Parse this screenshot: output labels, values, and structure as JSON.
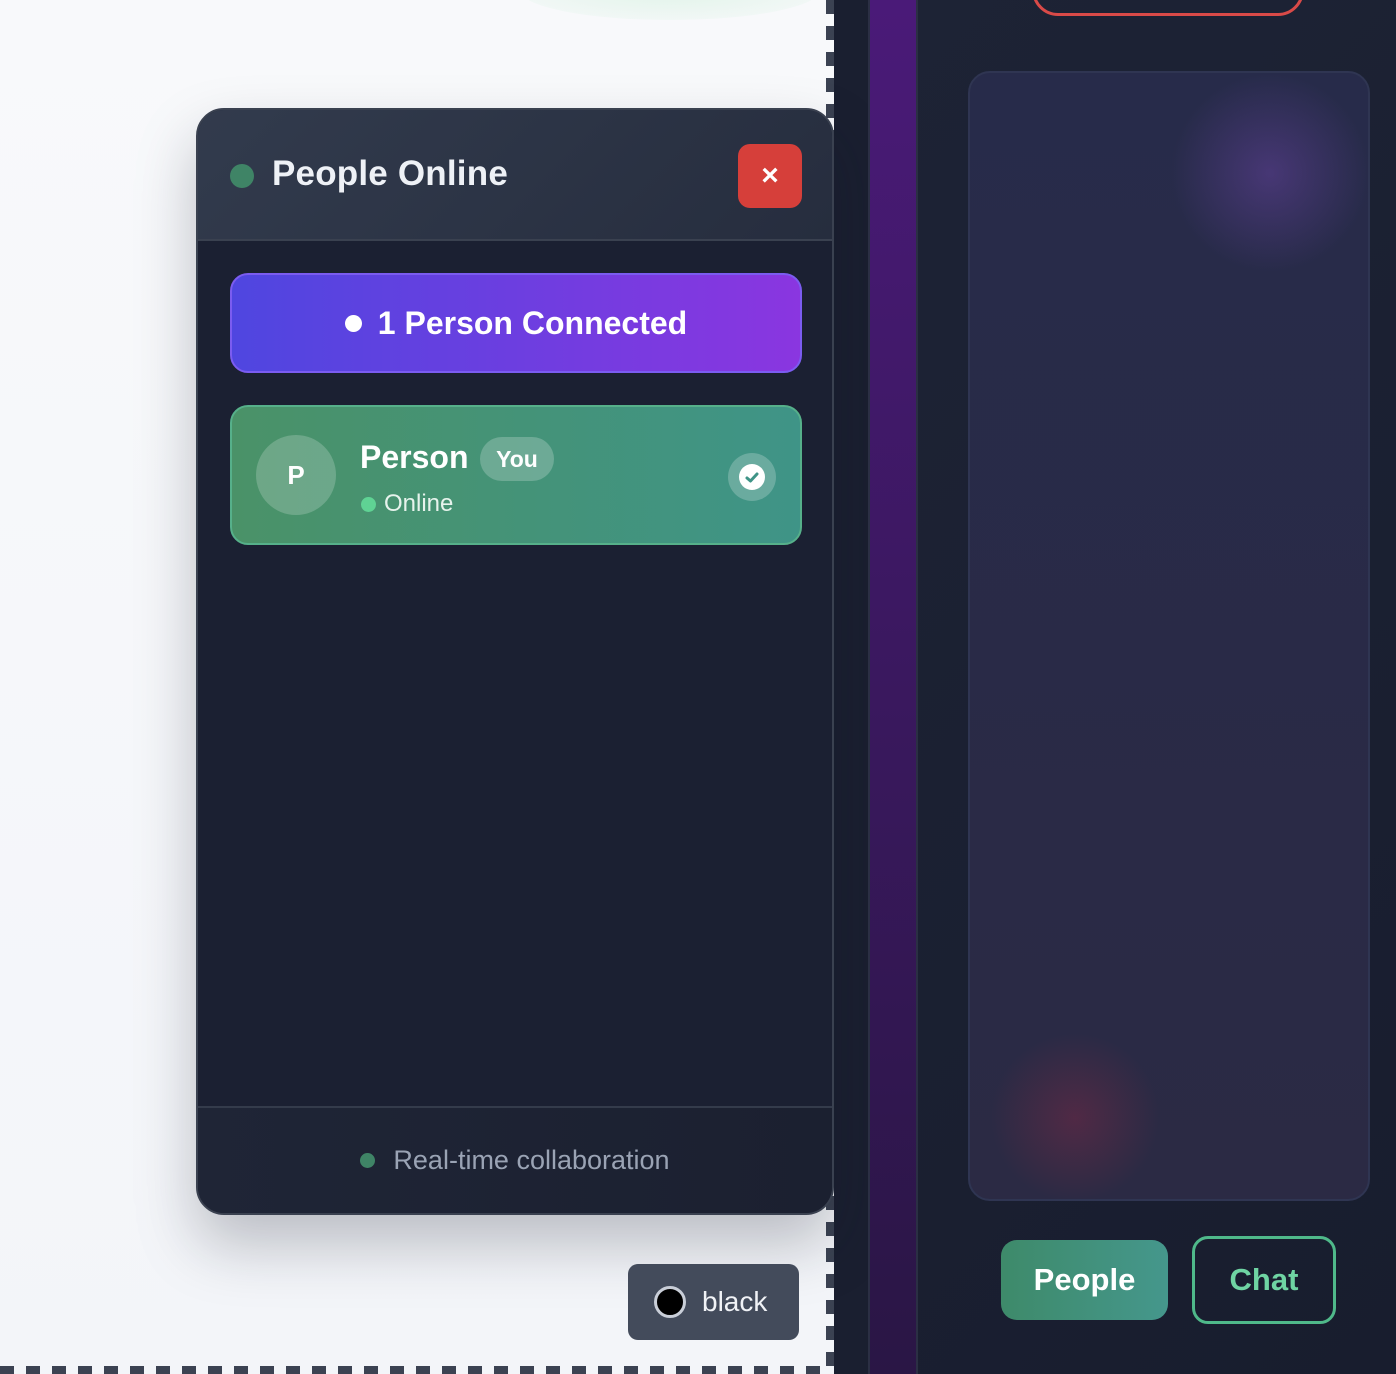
{
  "panel": {
    "title": "People Online",
    "close_label": "×",
    "connected_label": "1 Person Connected",
    "people": [
      {
        "initial": "P",
        "name": "Person",
        "badge": "You",
        "status": "Online"
      }
    ],
    "footer_text": "Real-time collaboration"
  },
  "color_chip": {
    "label": "black",
    "swatch_color": "#000000"
  },
  "sidebar": {
    "tabs": [
      {
        "label": "People",
        "active": true
      },
      {
        "label": "Chat",
        "active": false
      }
    ]
  },
  "colors": {
    "accent_green": "#3f8466",
    "close_red": "#d63f3a",
    "banner_start": "#4f46e0",
    "banner_end": "#8a36e0",
    "online_dot": "#5fd394"
  }
}
